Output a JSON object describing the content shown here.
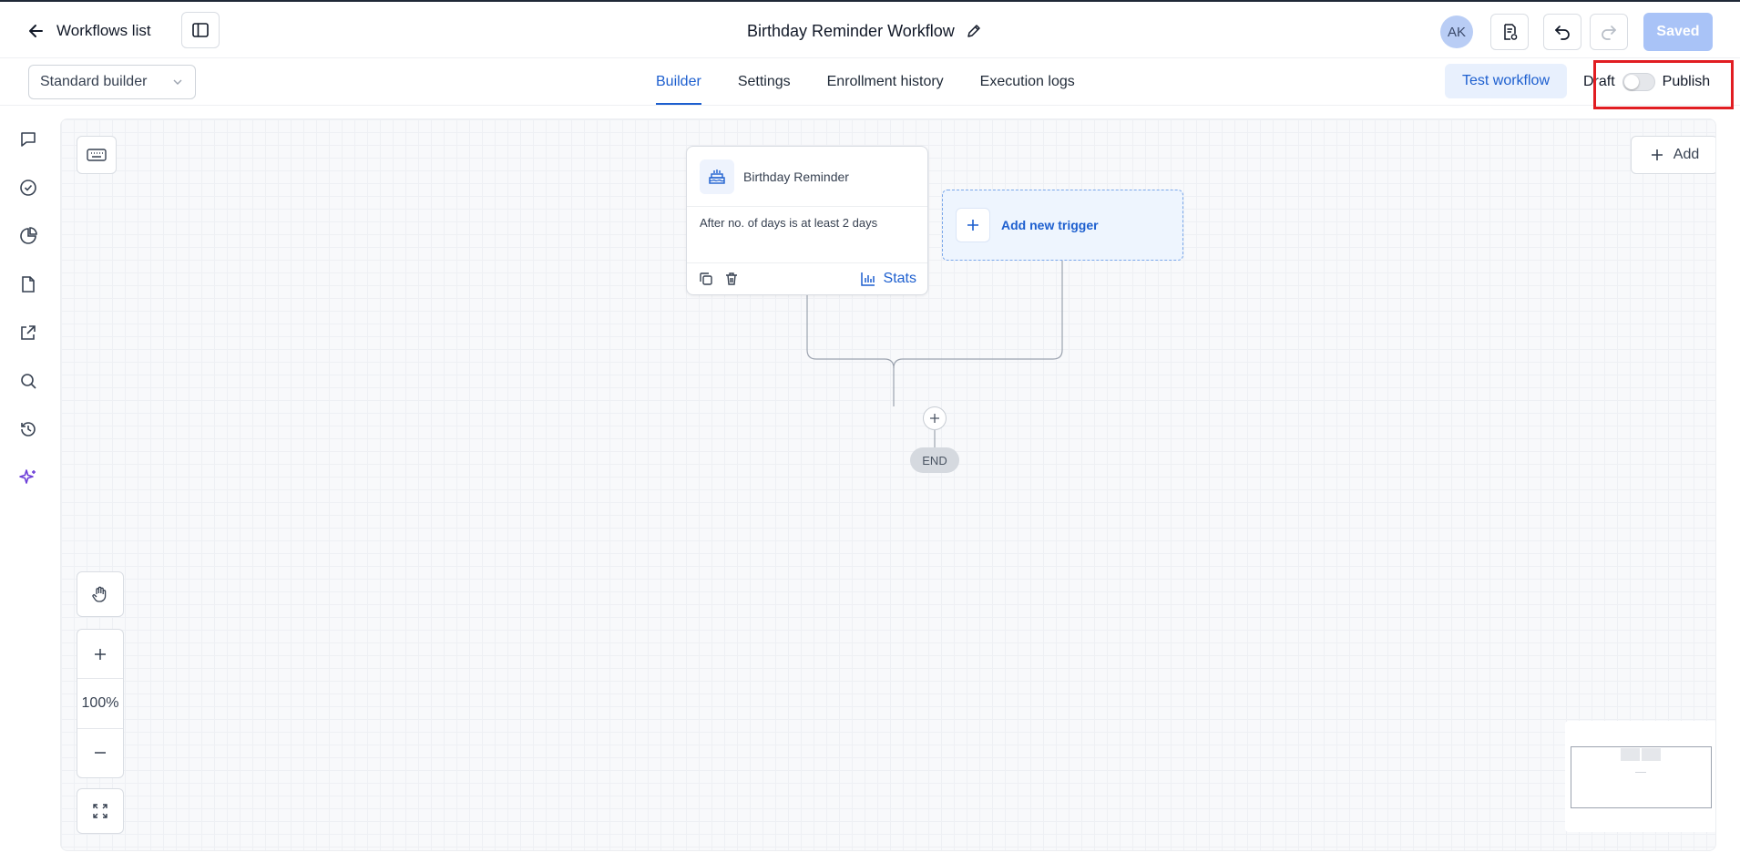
{
  "topbar": {
    "back_label": "Workflows list",
    "workflow_title": "Birthday Reminder Workflow",
    "avatar_initials": "AK",
    "saved_label": "Saved"
  },
  "subbar": {
    "builder_mode": "Standard builder",
    "tabs": [
      {
        "label": "Builder",
        "active": true
      },
      {
        "label": "Settings",
        "active": false
      },
      {
        "label": "Enrollment history",
        "active": false
      },
      {
        "label": "Execution logs",
        "active": false
      }
    ],
    "test_label": "Test workflow",
    "draft_label": "Draft",
    "publish_label": "Publish",
    "published": false
  },
  "sidebar": {
    "icons": [
      "chat-icon",
      "check-circle-icon",
      "pie-chart-icon",
      "file-icon",
      "external-link-icon",
      "search-icon",
      "history-icon",
      "sparkles-icon"
    ]
  },
  "canvas": {
    "add_label": "Add",
    "trigger": {
      "title": "Birthday Reminder",
      "condition": "After no. of days is at least 2 days",
      "stats_label": "Stats"
    },
    "new_trigger_label": "Add new trigger",
    "end_label": "END",
    "zoom_level": "100%"
  },
  "colors": {
    "accent": "#1d5fcf",
    "saved_button": "#a9c3f7",
    "highlight": "#e11d22"
  }
}
